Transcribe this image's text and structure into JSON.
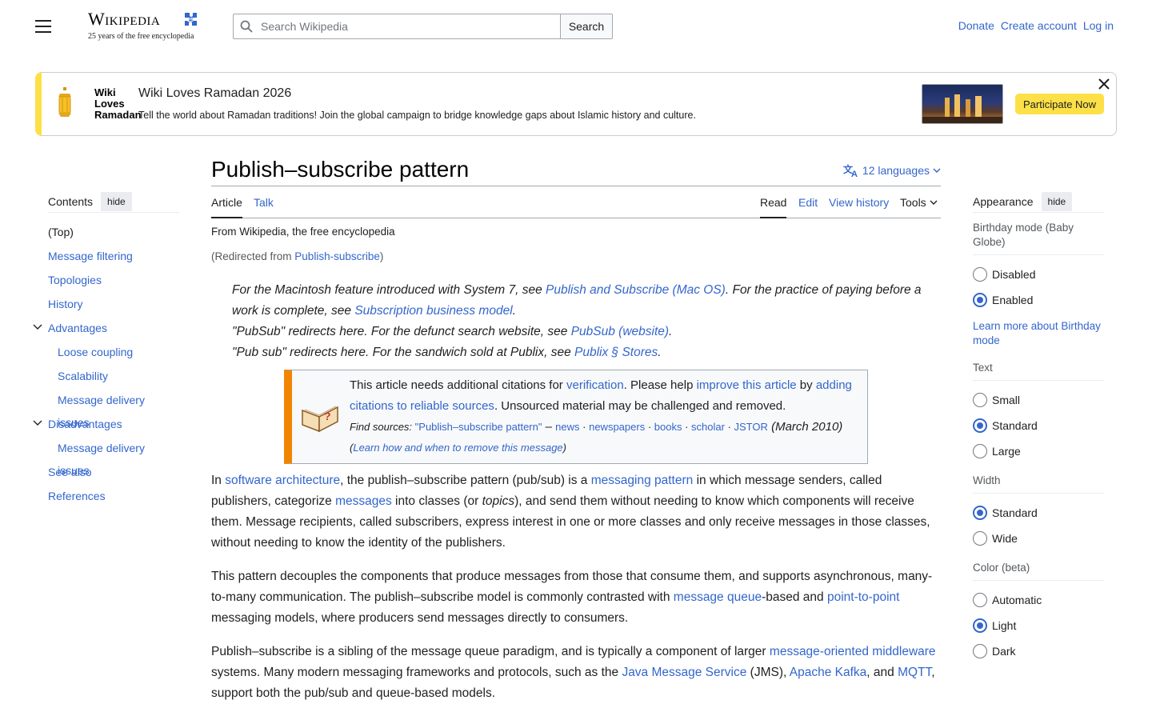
{
  "header": {
    "logo_word": "Wikipedia",
    "logo_tagline": "25 years of the free encyclopedia",
    "search_placeholder": "Search Wikipedia",
    "search_button": "Search",
    "links": [
      "Donate",
      "Create account",
      "Log in"
    ]
  },
  "banner": {
    "logo_lines": [
      "Wiki",
      "Loves",
      "Ramadan"
    ],
    "title": "Wiki Loves Ramadan 2026",
    "description": "Tell the world about Ramadan traditions! Join the global campaign to bridge knowledge gaps about Islamic history and culture.",
    "cta": "Participate Now",
    "accent": "#fde047"
  },
  "toc": {
    "title": "Contents",
    "hide": "hide",
    "items": [
      {
        "label": "(Top)",
        "level": 0,
        "top": true
      },
      {
        "label": "Message filtering",
        "level": 0
      },
      {
        "label": "Topologies",
        "level": 0
      },
      {
        "label": "History",
        "level": 0
      },
      {
        "label": "Advantages",
        "level": 0,
        "expandable": true
      },
      {
        "label": "Loose coupling",
        "level": 1
      },
      {
        "label": "Scalability",
        "level": 1
      },
      {
        "label": "Message delivery issues",
        "level": 1
      },
      {
        "label": "Disadvantages",
        "level": 0,
        "expandable": true
      },
      {
        "label": "Message delivery issues",
        "level": 1
      },
      {
        "label": "See also",
        "level": 0
      },
      {
        "label": "References",
        "level": 0
      }
    ]
  },
  "article": {
    "title": "Publish–subscribe pattern",
    "languages": "12 languages",
    "tabs_left": [
      "Article",
      "Talk"
    ],
    "tabs_right": [
      "Read",
      "Edit",
      "View history",
      "Tools"
    ],
    "tagline": "From Wikipedia, the free encyclopedia",
    "redirect_prefix": "(Redirected from ",
    "redirect_link": "Publish-subscribe",
    "redirect_suffix": ")",
    "hatnote1_a": "For the Macintosh feature introduced with System 7, see ",
    "hatnote1_link1": "Publish and Subscribe (Mac OS)",
    "hatnote1_b": ". For the practice of paying before a work is complete, see ",
    "hatnote1_link2": "Subscription business model",
    "hatnote1_c": ".",
    "hatnote2_a": "\"PubSub\" redirects here. For the defunct search website, see ",
    "hatnote2_link": "PubSub (website)",
    "hatnote2_b": ".",
    "hatnote3_a": "\"Pub sub\" redirects here. For the sandwich sold at Publix, see ",
    "hatnote3_link": "Publix § Stores",
    "hatnote3_b": ".",
    "ambox": {
      "a": "This article needs additional citations for ",
      "link1": "verification",
      "b": ". Please help ",
      "link2": "improve this article",
      "c": " by ",
      "link3": "adding citations to reliable sources",
      "d": ". Unsourced material may be challenged and removed.",
      "find": "Find sources: ",
      "src_quote": "\"Publish–subscribe pattern\"",
      "dash": " – ",
      "sources": [
        "news",
        "newspapers",
        "books",
        "scholar",
        "JSTOR"
      ],
      "date": " (March 2010)",
      "learn_open": "(",
      "learn": "Learn how and when to remove this message",
      "learn_close": ")"
    },
    "p1": {
      "a": "In ",
      "l1": "software architecture",
      "b": ", the publish–subscribe pattern (pub/sub) is a ",
      "l2": "messaging pattern",
      "c": " in which message senders, called publishers, categorize ",
      "l3": "messages",
      "d": " into classes (or ",
      "e": "topics",
      "f": "), and send them without needing to know which components will receive them. Message recipients, called subscribers, express interest in one or more classes and only receive messages in those classes, without needing to know the identity of the publishers."
    },
    "p2": {
      "a": "This pattern decouples the components that produce messages from those that consume them, and supports asynchronous, many-to-many communication. The publish–subscribe model is commonly contrasted with ",
      "l1": "message queue",
      "b": "-based and ",
      "l2": "point-to-point",
      "c": " messaging models, where producers send messages directly to consumers."
    },
    "p3": {
      "a": "Publish–subscribe is a sibling of the message queue paradigm, and is typically a component of larger ",
      "l1": "message-oriented middleware",
      "b": " systems. Many modern messaging frameworks and protocols, such as the ",
      "l2": "Java Message Service",
      "c": " (JMS), ",
      "l3": "Apache Kafka",
      "d": ", and ",
      "l4": "MQTT",
      "e": ", support both the pub/sub and queue-based models."
    }
  },
  "appearance": {
    "title": "Appearance",
    "hide": "hide",
    "birthday_label": "Birthday mode (Baby Globe)",
    "birthday_options": [
      "Disabled",
      "Enabled"
    ],
    "birthday_selected": "Enabled",
    "birthday_link": "Learn more about Birthday mode",
    "text_label": "Text",
    "text_options": [
      "Small",
      "Standard",
      "Large"
    ],
    "text_selected": "Standard",
    "width_label": "Width",
    "width_options": [
      "Standard",
      "Wide"
    ],
    "width_selected": "Standard",
    "color_label": "Color (beta)",
    "color_options": [
      "Automatic",
      "Light",
      "Dark"
    ],
    "color_selected": "Light"
  }
}
